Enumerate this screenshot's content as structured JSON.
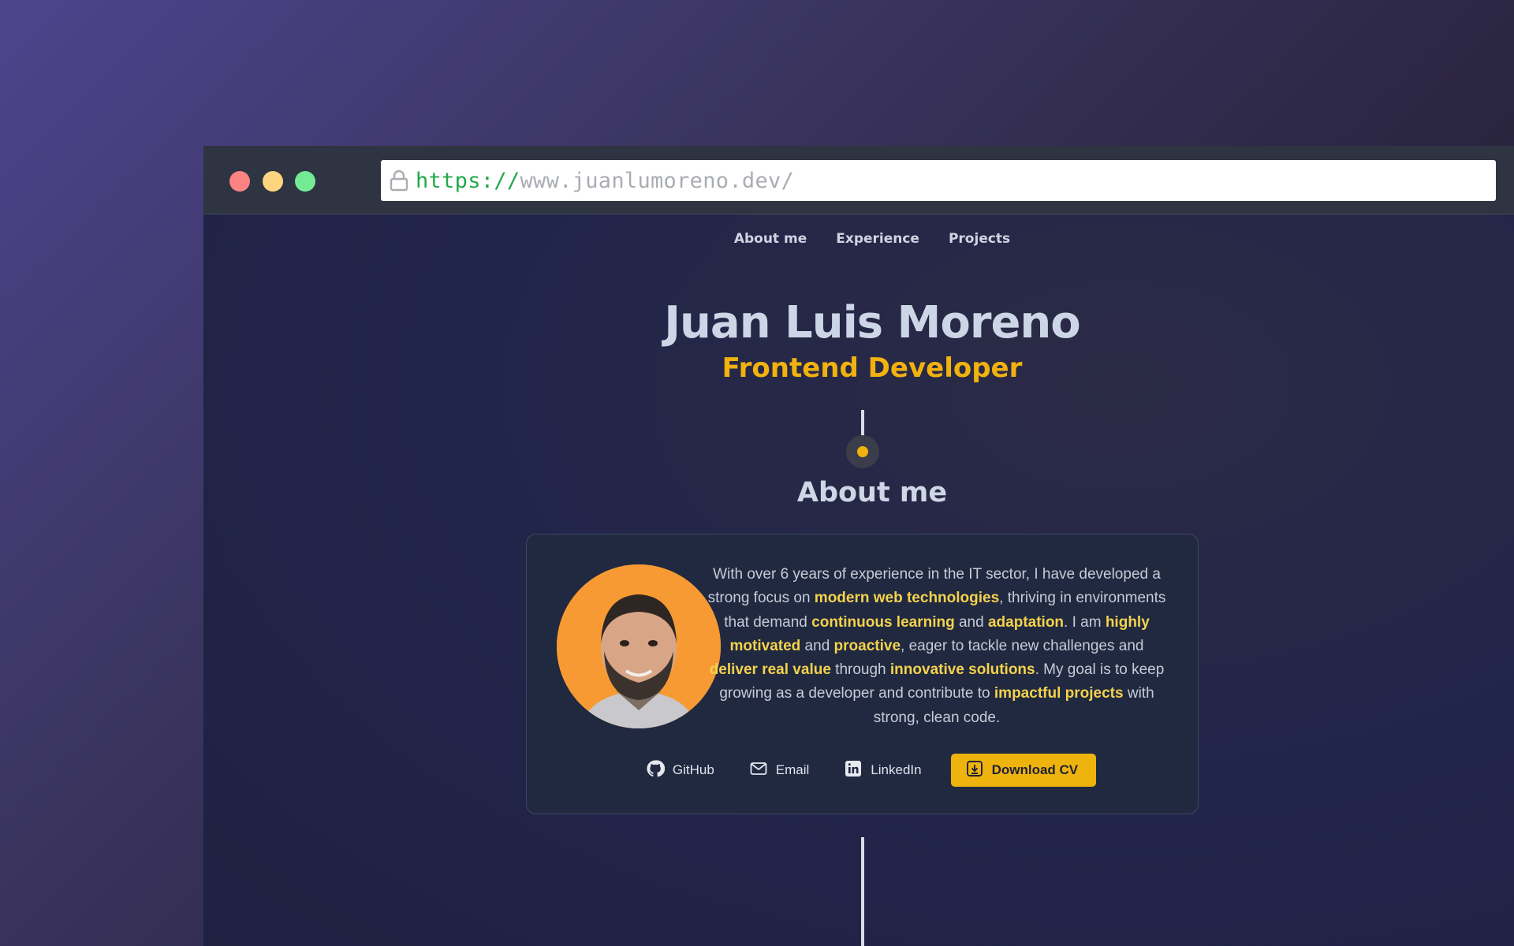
{
  "browser": {
    "url_protocol": "https://",
    "url_host": "www.juanlumoreno.dev/"
  },
  "nav": {
    "items": [
      "About me",
      "Experience",
      "Projects"
    ]
  },
  "hero": {
    "name": "Juan Luis Moreno",
    "role": "Frontend Developer"
  },
  "about": {
    "title": "About me",
    "bio": [
      {
        "t": "With over 6 years of experience in the IT sector, I have developed a strong focus on ",
        "hl": false
      },
      {
        "t": "modern web technologies",
        "hl": true
      },
      {
        "t": ", thriving in environments that demand ",
        "hl": false
      },
      {
        "t": "continuous learning",
        "hl": true
      },
      {
        "t": " and ",
        "hl": false
      },
      {
        "t": "adaptation",
        "hl": true
      },
      {
        "t": ". I am ",
        "hl": false
      },
      {
        "t": "highly motivated",
        "hl": true
      },
      {
        "t": " and ",
        "hl": false
      },
      {
        "t": "proactive",
        "hl": true
      },
      {
        "t": ", eager to tackle new challenges and ",
        "hl": false
      },
      {
        "t": "deliver real value",
        "hl": true
      },
      {
        "t": " through ",
        "hl": false
      },
      {
        "t": "innovative solutions",
        "hl": true
      },
      {
        "t": ". My goal is to keep growing as a developer and contribute to ",
        "hl": false
      },
      {
        "t": "impactful projects",
        "hl": true
      },
      {
        "t": " with strong, clean code.",
        "hl": false
      }
    ],
    "links": {
      "github": "GitHub",
      "email": "Email",
      "linkedin": "LinkedIn",
      "cv": "Download CV"
    }
  },
  "icons": {
    "lock": "lock-icon",
    "github": "github-icon",
    "email": "mail-icon",
    "linkedin": "linkedin-icon",
    "download": "download-icon"
  },
  "colors": {
    "accent": "#f1b20f",
    "highlight": "#f4d24c",
    "url_protocol": "#22a94b"
  }
}
